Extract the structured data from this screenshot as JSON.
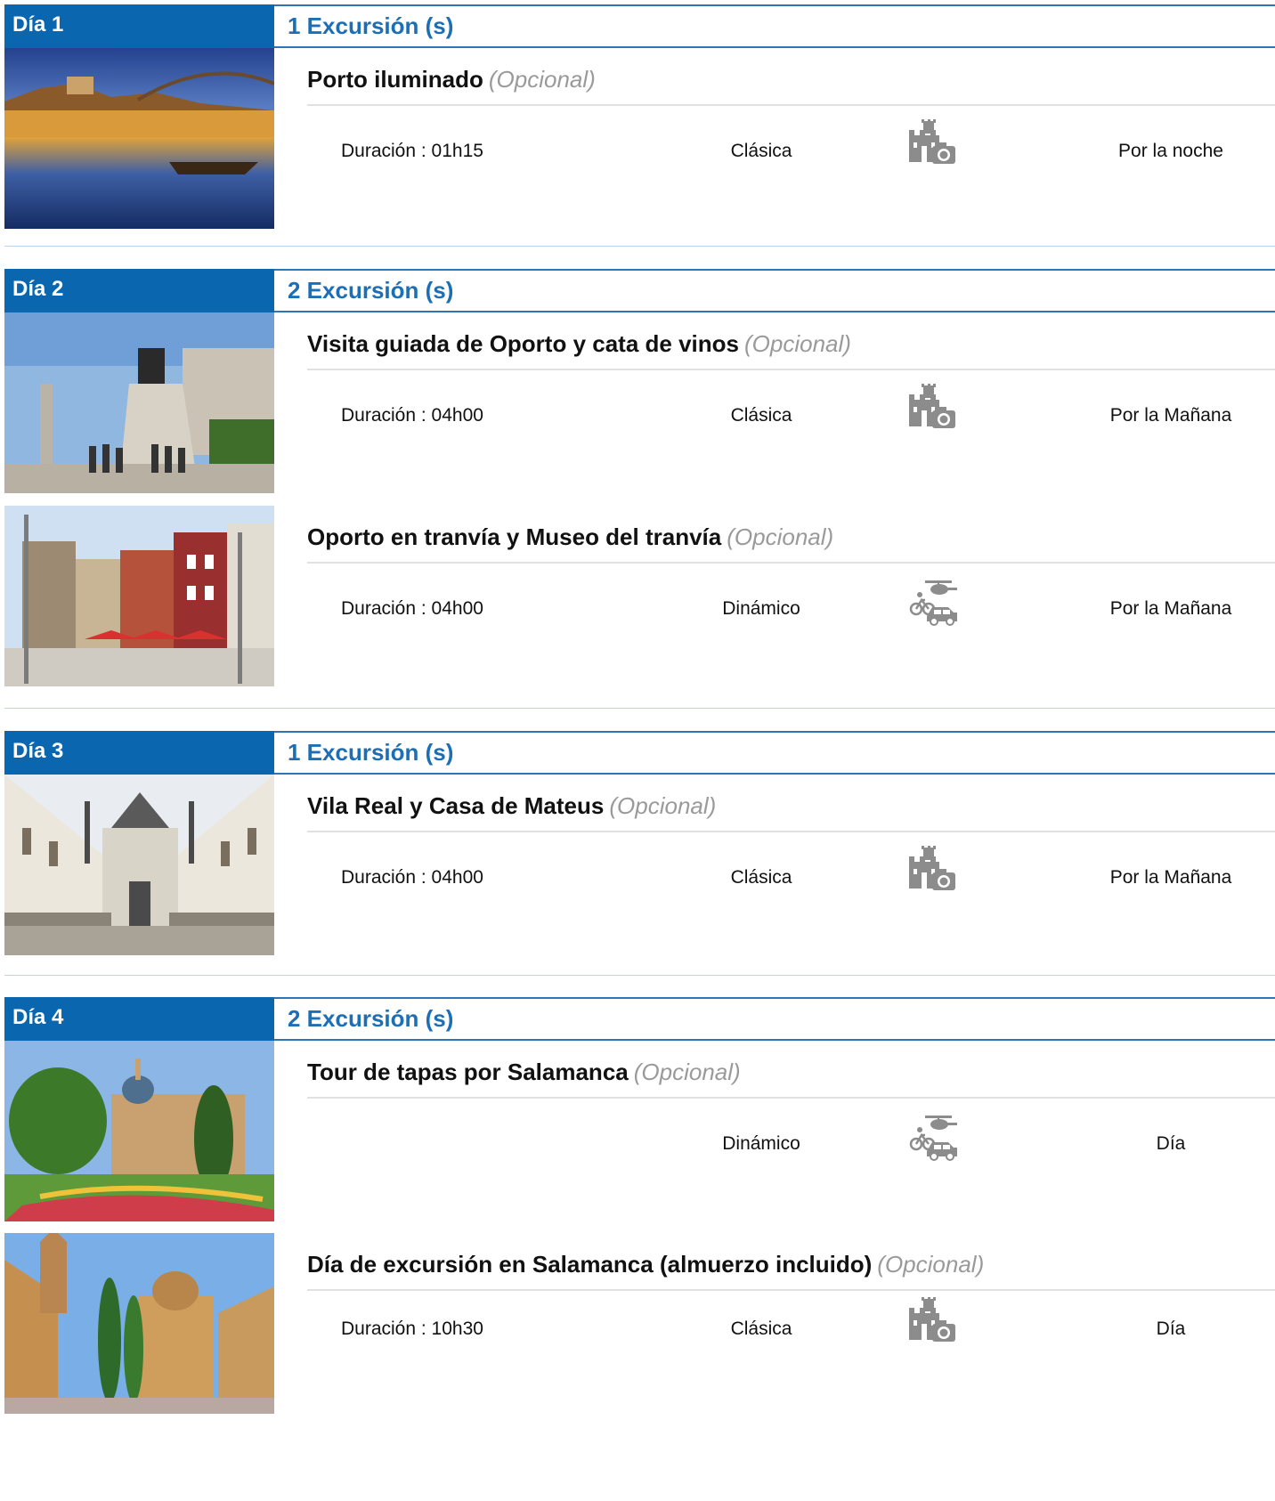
{
  "days": [
    {
      "label": "Día 1",
      "count": "1 Excursión (s)",
      "excursions": [
        {
          "title": "Porto iluminado",
          "optional": "(Opcional)",
          "duration": "Duración : 01h15",
          "style": "Clásica",
          "icon": "castle-camera-icon",
          "time": "Por la noche",
          "image": "porto-night-image"
        }
      ]
    },
    {
      "label": "Día 2",
      "count": "2 Excursión (s)",
      "excursions": [
        {
          "title": "Visita guiada de Oporto y cata de vinos",
          "optional": "(Opcional)",
          "duration": "Duración : 04h00",
          "style": "Clásica",
          "icon": "castle-camera-icon",
          "time": "Por la Mañana",
          "image": "statue-square-image"
        },
        {
          "title": "Oporto en tranvía y Museo del tranvía",
          "optional": "(Opcional)",
          "duration": "Duración : 04h00",
          "style": "Dinámico",
          "icon": "helicopter-bike-car-icon",
          "time": "Por la Mañana",
          "image": "ribeira-houses-image"
        }
      ]
    },
    {
      "label": "Día 3",
      "count": "1 Excursión (s)",
      "excursions": [
        {
          "title": "Vila Real y Casa de Mateus",
          "optional": "(Opcional)",
          "duration": "Duración : 04h00",
          "style": "Clásica",
          "icon": "castle-camera-icon",
          "time": "Por la Mañana",
          "image": "palace-facade-image"
        }
      ]
    },
    {
      "label": "Día 4",
      "count": "2 Excursión (s)",
      "excursions": [
        {
          "title": "Tour de tapas por Salamanca",
          "optional": "(Opcional)",
          "duration": "",
          "style": "Dinámico",
          "icon": "helicopter-bike-car-icon",
          "time": "Día",
          "image": "salamanca-garden-image"
        },
        {
          "title": "Día de excursión en Salamanca (almuerzo incluido)",
          "optional": "(Opcional)",
          "duration": "Duración : 10h30",
          "style": "Clásica",
          "icon": "castle-camera-icon",
          "time": "Día",
          "image": "salamanca-cathedral-image"
        }
      ]
    }
  ],
  "colors": {
    "day_bg": "#0a66ae",
    "count_text": "#1d6fb5",
    "optional_text": "#9a9a9a",
    "separator": "#bcd6ee"
  }
}
